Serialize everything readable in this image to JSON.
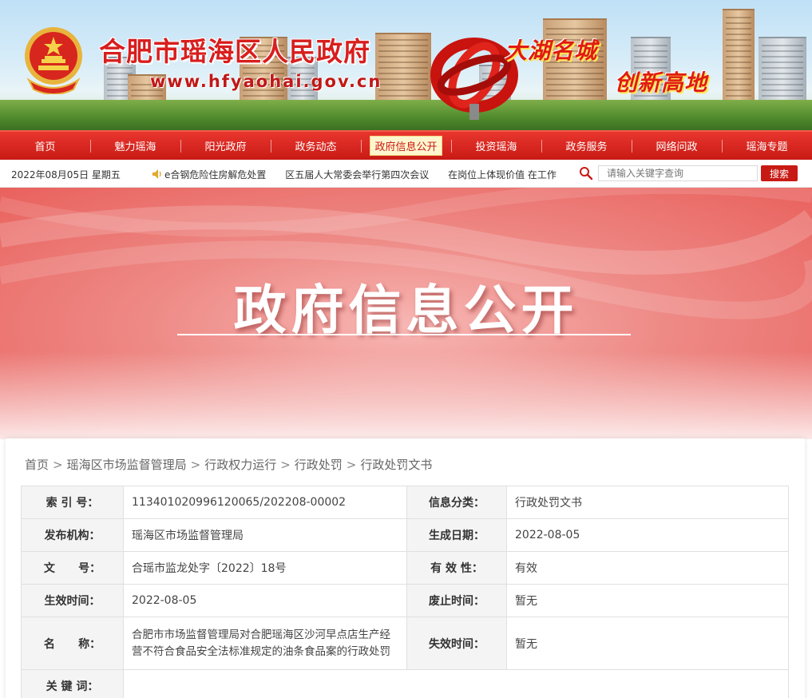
{
  "header": {
    "site_title": "合肥市瑶海区人民政府",
    "site_url": "www.hfyaohai.gov.cn",
    "slogan_line1": "大湖名城",
    "slogan_line2": "创新高地",
    "colors": {
      "brand_red": "#c81a14",
      "title_red": "#d81e1e",
      "slogan_yellow": "#ffe65a"
    }
  },
  "nav": {
    "items": [
      {
        "label": "首页"
      },
      {
        "label": "魅力瑶海"
      },
      {
        "label": "阳光政府"
      },
      {
        "label": "政务动态"
      },
      {
        "label": "政府信息公开",
        "active": true
      },
      {
        "label": "投资瑶海"
      },
      {
        "label": "政务服务"
      },
      {
        "label": "网络问政"
      },
      {
        "label": "瑶海专题"
      }
    ]
  },
  "infobar": {
    "date": "2022年08月05日 星期五",
    "ticker": [
      "e合钢危险住房解危处置",
      "区五届人大常委会举行第四次会议",
      "在岗位上体现价值 在工作"
    ],
    "search_placeholder": "请输入关键字查询",
    "search_button": "搜索",
    "icons": {
      "speaker": "speaker-icon",
      "search": "search-icon"
    }
  },
  "banner": {
    "title": "政府信息公开"
  },
  "breadcrumb": [
    "首页",
    "瑶海区市场监督管理局",
    "行政权力运行",
    "行政处罚",
    "行政处罚文书"
  ],
  "meta": {
    "index_no_label": "索 引 号：",
    "index_no": "11340102099612006​5/202208-00002",
    "category_label": "信息分类：",
    "category": "行政处罚文书",
    "publisher_label": "发布机构：",
    "publisher": "瑶海区市场监督管理局",
    "created_label": "生成日期：",
    "created": "2022-08-05",
    "doc_no_label_a": "文",
    "doc_no_label_b": "号：",
    "doc_no": "合瑶市监龙处字〔2022〕18号",
    "validity_label": "有 效 性：",
    "validity": "有效",
    "effective_label": "生效时间：",
    "effective": "2022-08-05",
    "abolish_label": "废止时间：",
    "abolish": "暂无",
    "name_label_a": "名",
    "name_label_b": "称：",
    "name": "合肥市市场监督管理局对合肥瑶海区沙河早点店生产经营不符合食品安全法标准规定的油条食品案的行政处罚",
    "expire_label": "失效时间：",
    "expire": "暂无",
    "keywords_label": "关 键 词：",
    "keywords": ""
  }
}
